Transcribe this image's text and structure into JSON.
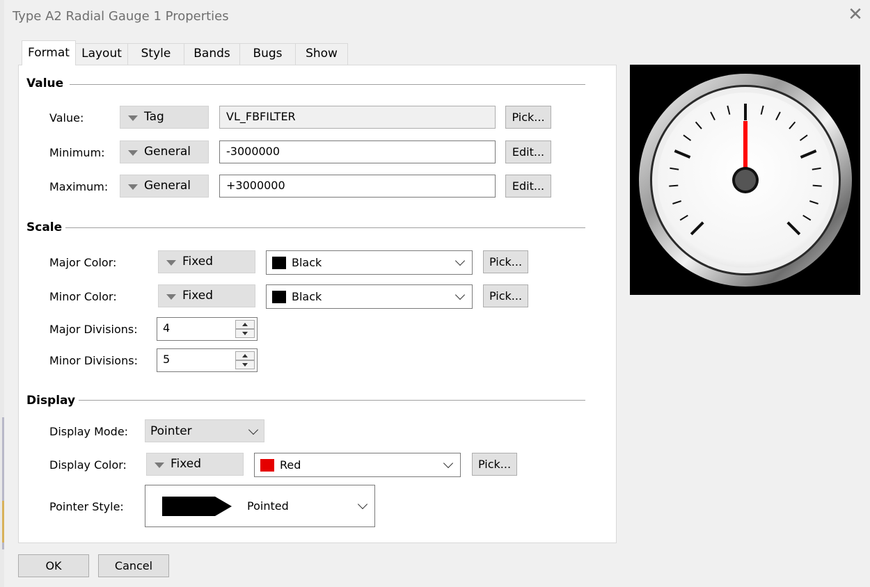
{
  "window": {
    "title": "Type A2 Radial Gauge 1 Properties"
  },
  "tabs": [
    {
      "label": "Format"
    },
    {
      "label": "Layout"
    },
    {
      "label": "Style"
    },
    {
      "label": "Bands"
    },
    {
      "label": "Bugs"
    },
    {
      "label": "Show"
    }
  ],
  "value_section": {
    "heading": "Value",
    "value": {
      "label": "Value:",
      "mode": "Tag",
      "text": "VL_FBFILTER",
      "button": "Pick..."
    },
    "minimum": {
      "label": "Minimum:",
      "mode": "General",
      "text": "-3000000",
      "button": "Edit..."
    },
    "maximum": {
      "label": "Maximum:",
      "mode": "General",
      "text": "+3000000",
      "button": "Edit..."
    }
  },
  "scale_section": {
    "heading": "Scale",
    "major_color": {
      "label": "Major Color:",
      "mode": "Fixed",
      "color_name": "Black",
      "swatch": "#000000",
      "button": "Pick..."
    },
    "minor_color": {
      "label": "Minor Color:",
      "mode": "Fixed",
      "color_name": "Black",
      "swatch": "#000000",
      "button": "Pick..."
    },
    "major_divisions": {
      "label": "Major Divisions:",
      "value": "4"
    },
    "minor_divisions": {
      "label": "Minor Divisions:",
      "value": "5"
    }
  },
  "display_section": {
    "heading": "Display",
    "display_mode": {
      "label": "Display Mode:",
      "value": "Pointer"
    },
    "display_color": {
      "label": "Display Color:",
      "mode": "Fixed",
      "color_name": "Red",
      "swatch": "#e50000",
      "button": "Pick..."
    },
    "pointer_style": {
      "label": "Pointer Style:",
      "value": "Pointed"
    }
  },
  "footer": {
    "ok": "OK",
    "cancel": "Cancel"
  },
  "preview": {
    "pointer_color": "#ff0000",
    "background": "#000000"
  }
}
